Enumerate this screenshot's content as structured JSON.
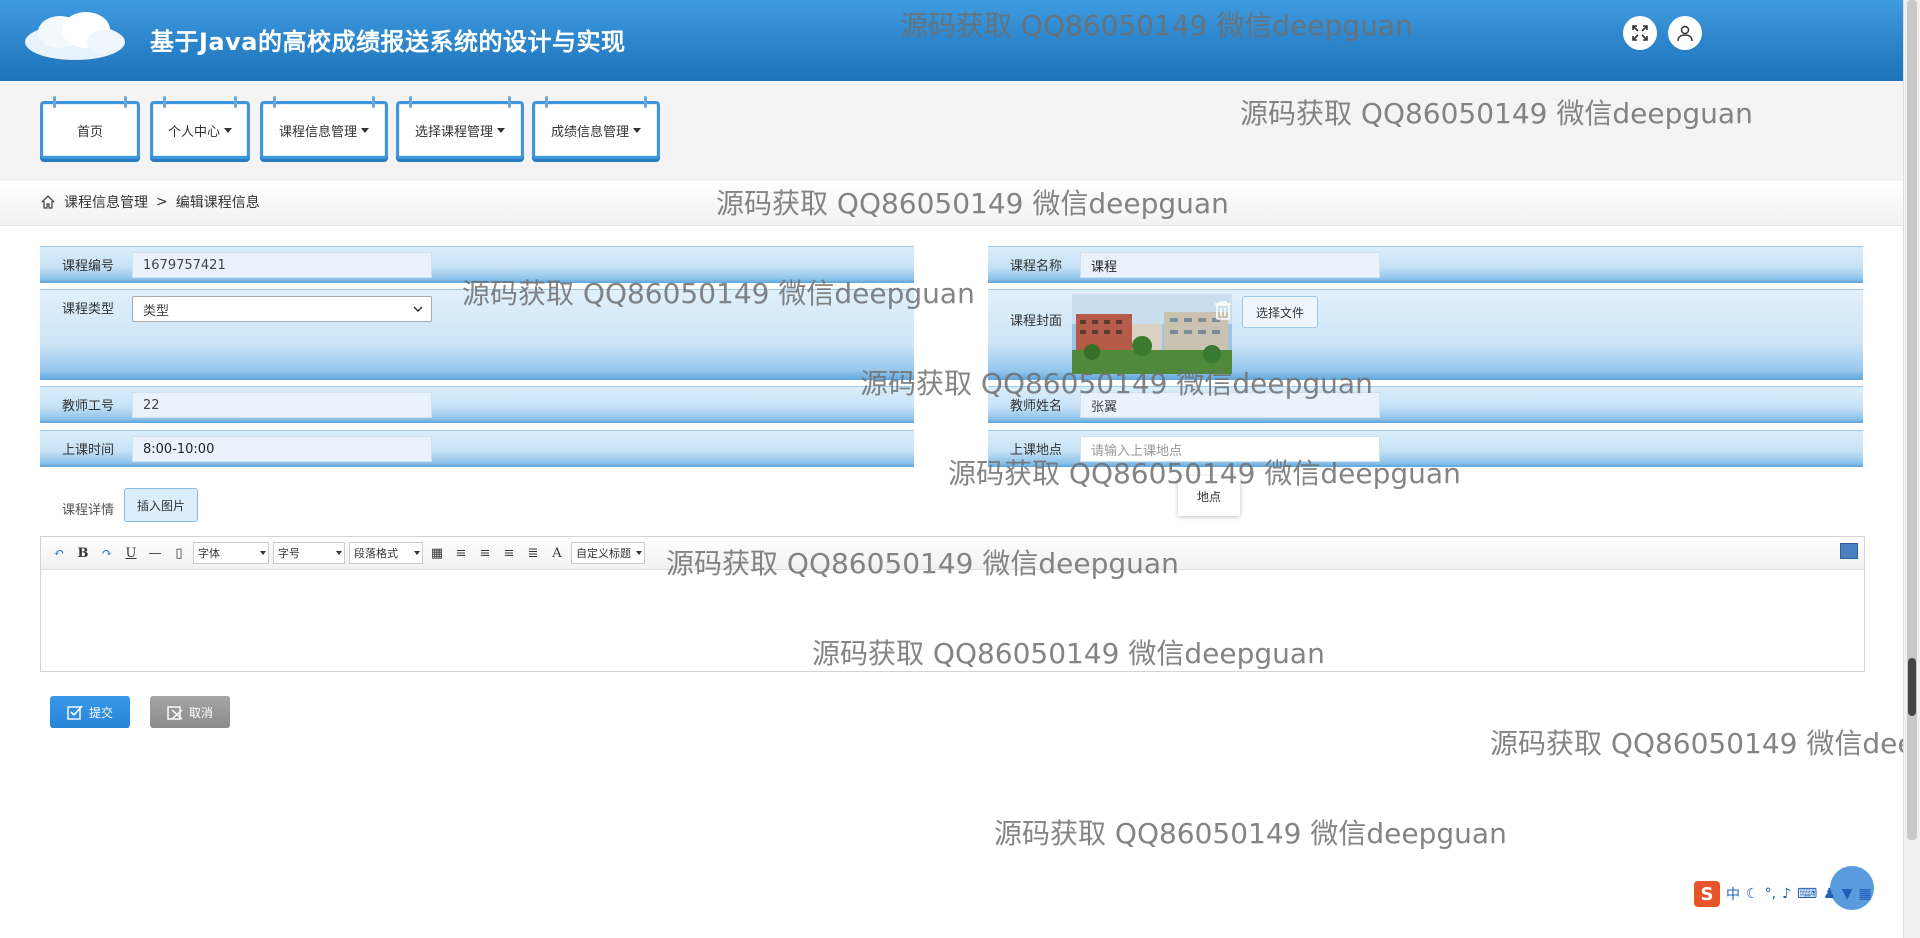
{
  "header": {
    "title": "基于Java的高校成绩报送系统的设计与实现",
    "icons": [
      "fullscreen-icon",
      "user-icon"
    ]
  },
  "nav": {
    "items": [
      {
        "label": "首页",
        "dropdown": false
      },
      {
        "label": "个人中心",
        "dropdown": true
      },
      {
        "label": "课程信息管理",
        "dropdown": true
      },
      {
        "label": "选择课程管理",
        "dropdown": true
      },
      {
        "label": "成绩信息管理",
        "dropdown": true
      }
    ]
  },
  "breadcrumb": {
    "section": "课程信息管理",
    "separator": ">",
    "current": "编辑课程信息"
  },
  "form": {
    "course_no": {
      "label": "课程编号",
      "value": "1679757421"
    },
    "course_name": {
      "label": "课程名称",
      "value": "课程"
    },
    "course_type": {
      "label": "课程类型",
      "value": "类型"
    },
    "course_cover": {
      "label": "课程封面",
      "file_button": "选择文件"
    },
    "teacher_no": {
      "label": "教师工号",
      "value": "22"
    },
    "teacher_name": {
      "label": "教师姓名",
      "value": "张翼"
    },
    "class_time": {
      "label": "上课时间",
      "value": "8:00-10:00"
    },
    "class_place": {
      "label": "上课地点",
      "placeholder": "请输入上课地点"
    },
    "suggestion": "地点",
    "detail_label": "课程详情",
    "insert_image": "插入图片"
  },
  "editor": {
    "font_family": "字体",
    "font_size": "字号",
    "paragraph": "段落格式",
    "custom_title": "自定义标题",
    "bold": "B",
    "underline": "U",
    "font_color": "A"
  },
  "actions": {
    "submit": "提交",
    "cancel": "取消"
  },
  "watermark": "源码获取 QQ86050149 微信deepguan",
  "ime": {
    "mode": "中"
  },
  "colors": {
    "header": "#2a82c8",
    "nav_border": "#3f97db",
    "submit": "#2783d6",
    "cancel": "#8c8c8c"
  }
}
